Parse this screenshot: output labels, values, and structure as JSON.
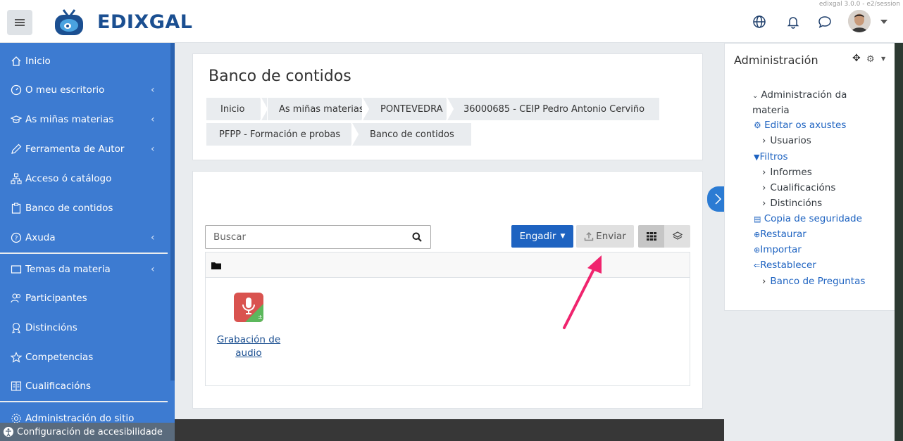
{
  "header": {
    "brand": "EDIXGAL",
    "version": "edixgal 3.0.0 - e2/session"
  },
  "sidebar": {
    "items": [
      {
        "label": "Inicio",
        "icon": "home-icon"
      },
      {
        "label": "O meu escritorio",
        "icon": "dashboard-icon",
        "expandable": true
      },
      {
        "label": "As miñas materias",
        "icon": "graduation-icon",
        "expandable": true
      },
      {
        "label": "Ferramenta de Autor",
        "icon": "pencil-icon",
        "expandable": true
      },
      {
        "label": "Acceso ó catálogo",
        "icon": "sitemap-icon"
      },
      {
        "label": "Banco de contidos",
        "icon": "clipboard-icon"
      },
      {
        "label": "Axuda",
        "icon": "help-icon",
        "expandable": true
      },
      {
        "label": "Temas da materia",
        "icon": "folder-icon",
        "expandable": true
      },
      {
        "label": "Participantes",
        "icon": "users-icon"
      },
      {
        "label": "Distincións",
        "icon": "award-icon"
      },
      {
        "label": "Competencias",
        "icon": "star-icon"
      },
      {
        "label": "Cualificacións",
        "icon": "gradebook-icon"
      },
      {
        "label": "Administración do sitio",
        "icon": "gear-icon"
      }
    ],
    "accessibility": "Configuración de accesibilidade"
  },
  "main": {
    "title": "Banco de contidos",
    "breadcrumb": [
      "Inicio",
      "As miñas materias",
      "PONTEVEDRA",
      "36000685 - CEIP Pedro Antonio Cerviño",
      "PFPP - Formación e probas",
      "Banco de contidos"
    ],
    "search_placeholder": "Buscar",
    "add_label": "Engadir",
    "send_label": "Enviar",
    "file": {
      "name": "Grabación de audio"
    }
  },
  "admin_panel": {
    "title": "Administración",
    "tree": [
      {
        "label": "Administración da materia",
        "type": "section"
      },
      {
        "label": "Editar os axustes",
        "type": "link",
        "icon": "gear-icon"
      },
      {
        "label": "Usuarios",
        "type": "collapsed"
      },
      {
        "label": "Filtros",
        "type": "link",
        "icon": "filter-icon"
      },
      {
        "label": "Informes",
        "type": "collapsed"
      },
      {
        "label": "Cualificacións",
        "type": "collapsed"
      },
      {
        "label": "Distincións",
        "type": "collapsed"
      },
      {
        "label": "Copia de seguridade",
        "type": "link",
        "icon": "file-icon"
      },
      {
        "label": "Restaurar",
        "type": "link",
        "icon": "upload-icon"
      },
      {
        "label": "Importar",
        "type": "link",
        "icon": "upload-icon"
      },
      {
        "label": "Restablecer",
        "type": "link",
        "icon": "reset-icon"
      },
      {
        "label": "Banco de Preguntas",
        "type": "collapsed-link"
      }
    ]
  },
  "colors": {
    "sidebar": "#3d7bd1",
    "brand": "#1b4f91",
    "primary": "#1e63c1",
    "annotation_arrow": "#f0246e"
  }
}
